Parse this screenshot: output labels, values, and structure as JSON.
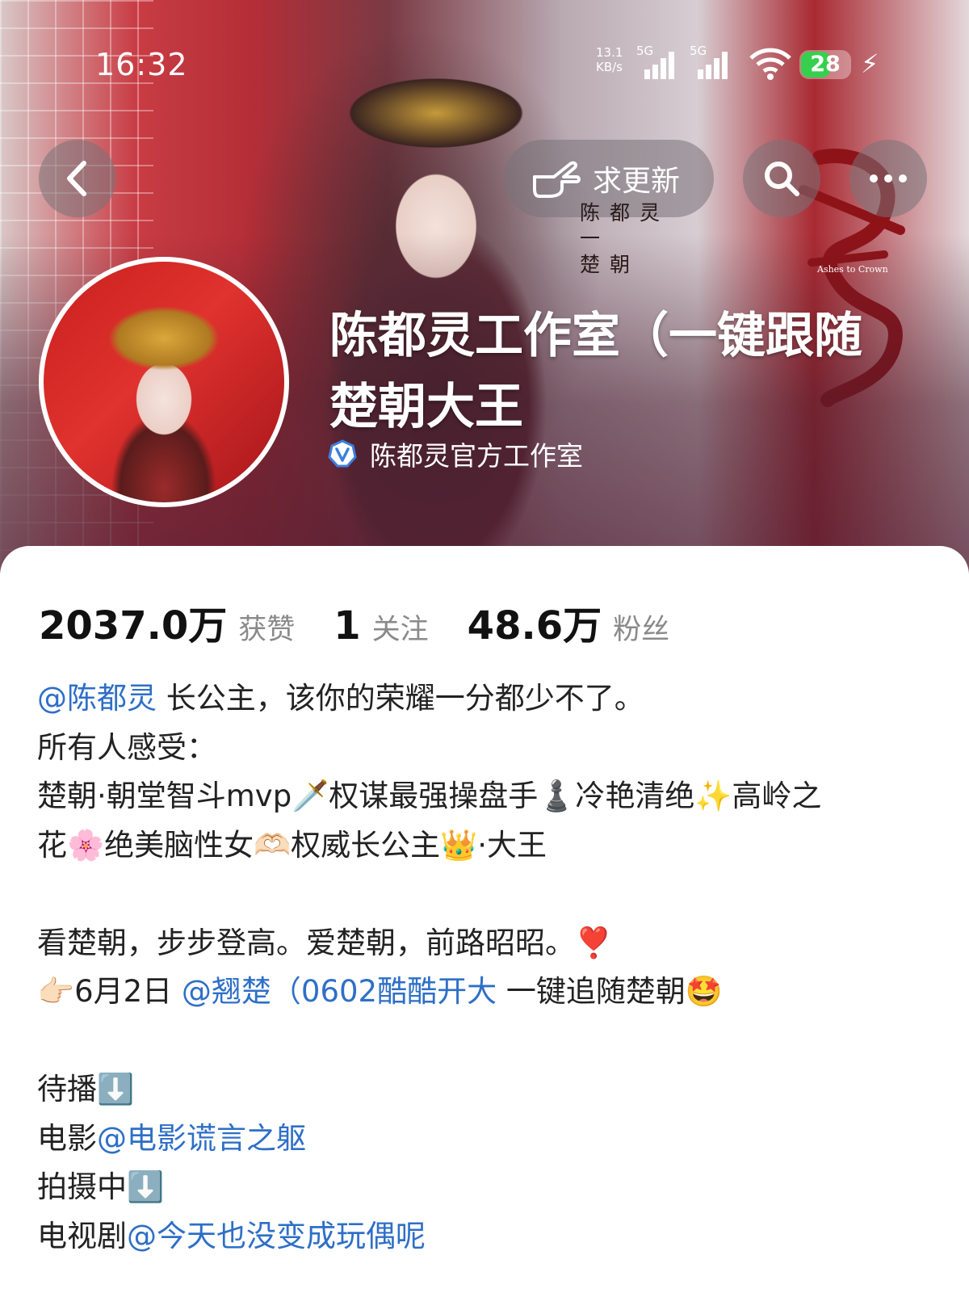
{
  "status_bar": {
    "time": "16:32",
    "net_speed": "13.1",
    "net_unit": "KB/s",
    "sim1": "5G",
    "sim2": "5G",
    "battery": "28"
  },
  "header": {
    "request_update_label": "求更新"
  },
  "poster": {
    "line1": "陈都灵",
    "line2": "一",
    "line3": "楚朝",
    "subtitle": "Ashes to Crown"
  },
  "profile": {
    "name_line1": "陈都灵工作室（一键跟随",
    "name_line2": "楚朝大王",
    "verified_label": "陈都灵官方工作室"
  },
  "stats": {
    "likes_value": "2037.0万",
    "likes_label": "获赞",
    "following_value": "1",
    "following_label": "关注",
    "followers_value": "48.6万",
    "followers_label": "粉丝"
  },
  "bio": {
    "l1_mention": "@陈都灵",
    "l1_text": " 长公主，该你的荣耀一分都少不了。",
    "l2": "所有人感受：",
    "l3": "楚朝·朝堂智斗mvp🗡️权谋最强操盘手♟️冷艳清绝✨高岭之",
    "l4": "花🌸绝美脑性女🫶🏻权威长公主👑·大王",
    "l5": "看楚朝，步步登高。爱楚朝，前路昭昭。❣️",
    "l6_prefix": "👉🏻6月2日 ",
    "l6_mention": "@翘楚（0602酷酷开大",
    "l6_suffix": " 一键追随楚朝🤩",
    "l7": "待播⬇️",
    "l8_prefix": "电影",
    "l8_mention": "@电影谎言之躯",
    "l9": "拍摄中⬇️",
    "l10_prefix": "电视剧",
    "l10_mention": "@今天也没变成玩偶呢"
  },
  "colors": {
    "link": "#2e6fc7",
    "verify_badge": "#3d7fe0",
    "battery": "#36d04e"
  }
}
